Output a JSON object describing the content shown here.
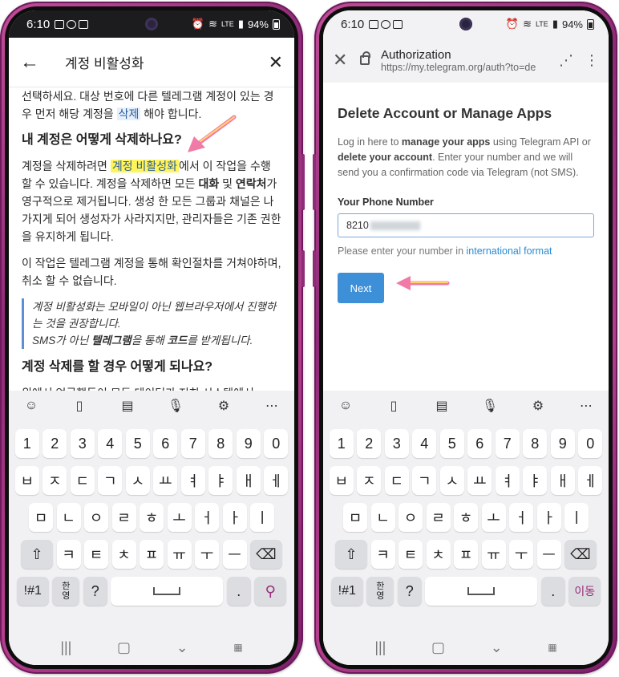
{
  "left_phone": {
    "status": {
      "time": "6:10",
      "battery": "94%",
      "network": "LTE"
    },
    "appbar": {
      "title": "계정 비활성화",
      "back_icon": "arrow-left-icon",
      "close_icon": "close-icon"
    },
    "article": {
      "p1_a": "선택하세요. 대상 번호에 다른 텔레그램 계정이 있는 경우 먼저 해당 계정을 ",
      "p1_link": "삭제",
      "p1_b": " 해야 합니다.",
      "h1": "내 계정은 어떻게 삭제하나요?",
      "p2_a": "계정을 삭제하려면 ",
      "p2_link": "계정 비활성화",
      "p2_b": "에서 이 작업을 수행 할 수 있습니다. 계정을 삭제하면 모든 ",
      "p2_bold1": "대화",
      "p2_c": " 및 ",
      "p2_bold2": "연락처",
      "p2_d": "가 영구적으로 제거됩니다. 생성 한 모든 그룹과 채널은 나가지게 되어 생성자가 사라지지만, 관리자들은 기존 권한을 유지하게 됩니다.",
      "p3": "이 작업은 텔레그램 계정을 통해 확인절차를 거쳐야하며, 취소 할 수 없습니다.",
      "quote_l1": "계정 비활성화는 모바일이 아닌 웹브라우저에서 진행하는 것을 권장합니다.",
      "quote_l2_a": "SMS가 아닌 ",
      "quote_l2_bold1": "텔레그램",
      "quote_l2_b": "을 통해 ",
      "quote_l2_bold2": "코드",
      "quote_l2_c": "를 받게됩니다.",
      "h2": "계정 삭제를 할 경우 어떻게 되나요?",
      "p4": "위에서 언급했듯이 모든 데이터가 저희 시스템에서"
    },
    "keyboard": {
      "action_label": "search-icon"
    }
  },
  "right_phone": {
    "status": {
      "time": "6:10",
      "battery": "94%",
      "network": "LTE"
    },
    "browser": {
      "title": "Authorization",
      "url": "https://my.telegram.org/auth?to=de"
    },
    "page": {
      "heading": "Delete Account or Manage Apps",
      "desc_a": "Log in here to ",
      "desc_b1": "manage your apps",
      "desc_c": " using Telegram API or ",
      "desc_b2": "delete your account",
      "desc_d": ". Enter your number and we will send you a confirmation code via Telegram (not SMS).",
      "phone_label": "Your Phone Number",
      "phone_value": "8210",
      "hint_a": "Please enter your number in ",
      "hint_link": "international format",
      "next_label": "Next"
    },
    "keyboard": {
      "action_label": "이동"
    }
  },
  "keyboard_layout": {
    "numbers": [
      "1",
      "2",
      "3",
      "4",
      "5",
      "6",
      "7",
      "8",
      "9",
      "0"
    ],
    "row1": [
      "ㅂ",
      "ㅈ",
      "ㄷ",
      "ㄱ",
      "ㅅ",
      "ㅛ",
      "ㅕ",
      "ㅑ",
      "ㅐ",
      "ㅔ"
    ],
    "row2": [
      "ㅁ",
      "ㄴ",
      "ㅇ",
      "ㄹ",
      "ㅎ",
      "ㅗ",
      "ㅓ",
      "ㅏ",
      "ㅣ"
    ],
    "row3": [
      "ㅋ",
      "ㅌ",
      "ㅊ",
      "ㅍ",
      "ㅠ",
      "ㅜ",
      "ㅡ"
    ],
    "sym_key": "!#1",
    "lang_key_top": "한",
    "lang_key_bottom": "영",
    "question_key": "?",
    "period_key": "."
  },
  "colors": {
    "accent_arrow": "#f07ba7",
    "highlight": "#fff45a",
    "link": "#2a8bd1",
    "next_button": "#3d8fd7",
    "phone_frame": "#9c3282"
  }
}
